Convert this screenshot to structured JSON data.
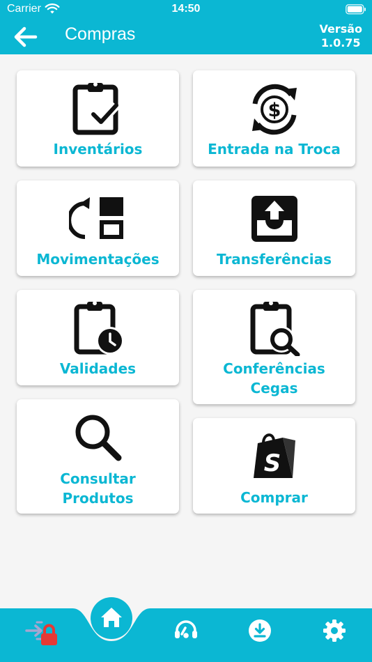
{
  "status_bar": {
    "carrier": "Carrier",
    "time": "14:50"
  },
  "header": {
    "title": "Compras",
    "version_line1": "Versão",
    "version_line2": "1.0.75"
  },
  "menu": {
    "inventarios": "Inventários",
    "entrada_troca": "Entrada na Troca",
    "movimentacoes": "Movimentações",
    "transferencias": "Transferências",
    "validades": "Validades",
    "conferencias_line1": "Conferências",
    "conferencias_line2": "Cegas",
    "consultar_line1": "Consultar",
    "consultar_line2": "Produtos",
    "comprar": "Comprar"
  },
  "bottom_nav": {
    "items": [
      "logout-lock-icon",
      "home-icon",
      "support-headset-icon",
      "download-icon",
      "gear-icon"
    ],
    "active": "home-icon"
  },
  "colors": {
    "accent": "#0bb7d3",
    "background": "#f5f5f5",
    "lock": "#e53935"
  }
}
